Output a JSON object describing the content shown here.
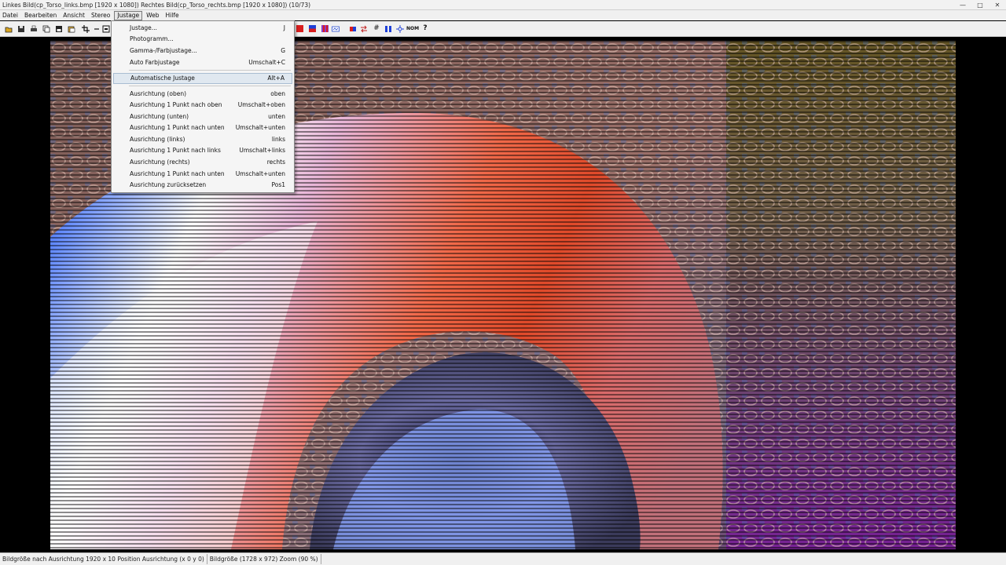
{
  "window": {
    "title": "Linkes Bild(cp_Torso_links.bmp [1920 x 1080]) Rechtes Bild(cp_Torso_rechts.bmp [1920 x 1080]) (10/73)",
    "minimize": "—",
    "maximize": "□",
    "close": "✕"
  },
  "menubar": {
    "items": [
      {
        "label": "Datei"
      },
      {
        "label": "Bearbeiten"
      },
      {
        "label": "Ansicht"
      },
      {
        "label": "Stereo"
      },
      {
        "label": "Justage"
      },
      {
        "label": "Web"
      },
      {
        "label": "Hilfe"
      }
    ]
  },
  "toolbar": {
    "icons": [
      "open-icon",
      "save-icon",
      "print-icon",
      "copy-icon",
      "save-all-icon",
      "paste-icon",
      "crop-icon",
      "arrow-icon",
      "frame-icon",
      "red-icon",
      "blue-red-icon",
      "purple-icon",
      "split-icon",
      "anaglyph-icon",
      "swap-icon",
      "grid-icon",
      "parallel-icon",
      "star-icon",
      "nom-icon",
      "help-icon"
    ],
    "nom_label": "NOM",
    "help_label": "?",
    "colors": {
      "red": "#d81e1e",
      "blue": "#1e40d8",
      "purple": "#8a3ac8"
    }
  },
  "justage_menu": {
    "items": [
      {
        "label": "Justage...",
        "shortcut": "J"
      },
      {
        "label": "Photogramm...",
        "shortcut": ""
      },
      {
        "label": "Gamma-/Farbjustage...",
        "shortcut": "G"
      },
      {
        "label": "Auto Farbjustage",
        "shortcut": "Umschalt+C"
      },
      {
        "label": "Automatische Justage",
        "shortcut": "Alt+A"
      },
      {
        "label": "Ausrichtung (oben)",
        "shortcut": "oben"
      },
      {
        "label": "Ausrichtung 1 Punkt nach oben",
        "shortcut": "Umschalt+oben"
      },
      {
        "label": "Ausrichtung (unten)",
        "shortcut": "unten"
      },
      {
        "label": "Ausrichtung 1 Punkt nach unten",
        "shortcut": "Umschalt+unten"
      },
      {
        "label": "Ausrichtung (links)",
        "shortcut": "links"
      },
      {
        "label": "Ausrichtung 1 Punkt nach links",
        "shortcut": "Umschalt+links"
      },
      {
        "label": "Ausrichtung (rechts)",
        "shortcut": "rechts"
      },
      {
        "label": "Ausrichtung 1 Punkt nach unten",
        "shortcut": "Umschalt+unten"
      },
      {
        "label": "Ausrichtung zurücksetzen",
        "shortcut": "Pos1"
      }
    ]
  },
  "statusbar": {
    "alignment": "Bildgröße nach Ausrichtung 1920 x 10 Position Ausrichtung (x    0 y    0)",
    "size_zoom": "Bildgröße (1728 x 972)  Zoom (90 %)"
  }
}
